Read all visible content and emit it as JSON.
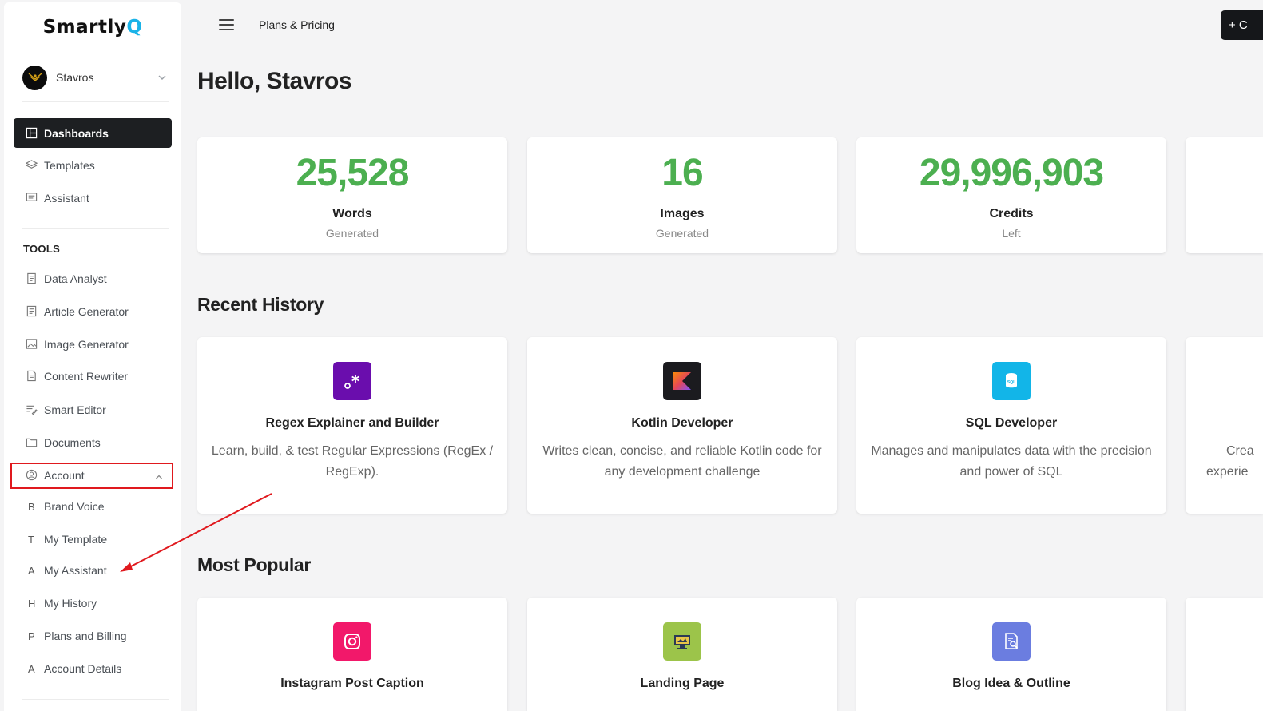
{
  "app": {
    "logo_main": "Smartly",
    "logo_accent": "Q"
  },
  "user": {
    "name": "Stavros"
  },
  "nav": {
    "main": [
      {
        "label": "Dashboards",
        "icon": "dashboard-icon"
      },
      {
        "label": "Templates",
        "icon": "layers-icon"
      },
      {
        "label": "Assistant",
        "icon": "chat-icon"
      }
    ],
    "tools_heading": "TOOLS",
    "tools": [
      {
        "label": "Data Analyst",
        "icon": "document-icon"
      },
      {
        "label": "Article Generator",
        "icon": "document-icon"
      },
      {
        "label": "Image Generator",
        "icon": "image-icon"
      },
      {
        "label": "Content Rewriter",
        "icon": "document-icon"
      },
      {
        "label": "Smart Editor",
        "icon": "edit-icon"
      },
      {
        "label": "Documents",
        "icon": "folder-icon"
      },
      {
        "label": "Account",
        "icon": "user-circle-icon"
      }
    ],
    "account_sub": [
      {
        "letter": "B",
        "label": "Brand Voice"
      },
      {
        "letter": "T",
        "label": "My Template"
      },
      {
        "letter": "A",
        "label": "My Assistant"
      },
      {
        "letter": "H",
        "label": "My History"
      },
      {
        "letter": "P",
        "label": "Plans and Billing"
      },
      {
        "letter": "A",
        "label": "Account Details"
      }
    ]
  },
  "topbar": {
    "title": "Plans & Pricing",
    "button_label": "+ C"
  },
  "greeting": "Hello, Stavros",
  "stats": [
    {
      "value": "25,528",
      "label": "Words",
      "sub": "Generated"
    },
    {
      "value": "16",
      "label": "Images",
      "sub": "Generated"
    },
    {
      "value": "29,996,903",
      "label": "Credits",
      "sub": "Left"
    }
  ],
  "recent_history": {
    "title": "Recent History",
    "items": [
      {
        "title": "Regex Explainer and Builder",
        "desc": "Learn, build, & test Regular Expressions (RegEx / RegExp).",
        "icon": "regex-icon",
        "color": "#6a0dad"
      },
      {
        "title": "Kotlin Developer",
        "desc": "Writes clean, concise, and reliable Kotlin code for any development challenge",
        "icon": "kotlin-icon",
        "color": "#1b1b1f"
      },
      {
        "title": "SQL Developer",
        "desc": "Manages and manipulates data with the precision and power of SQL",
        "icon": "sql-icon",
        "color": "#12b5e8"
      }
    ],
    "partial_desc_1": "Crea",
    "partial_desc_2": "experie"
  },
  "most_popular": {
    "title": "Most Popular",
    "items": [
      {
        "title": "Instagram Post Caption",
        "icon": "instagram-icon",
        "color": "#f2186a"
      },
      {
        "title": "Landing Page",
        "icon": "monitor-icon",
        "color": "#9cc44a"
      },
      {
        "title": "Blog Idea & Outline",
        "icon": "document-search-icon",
        "color": "#6b7de0"
      }
    ]
  },
  "colors": {
    "accent_green": "#4caf50",
    "annotation_red": "#e0191e",
    "active_nav": "#1d1f22"
  }
}
